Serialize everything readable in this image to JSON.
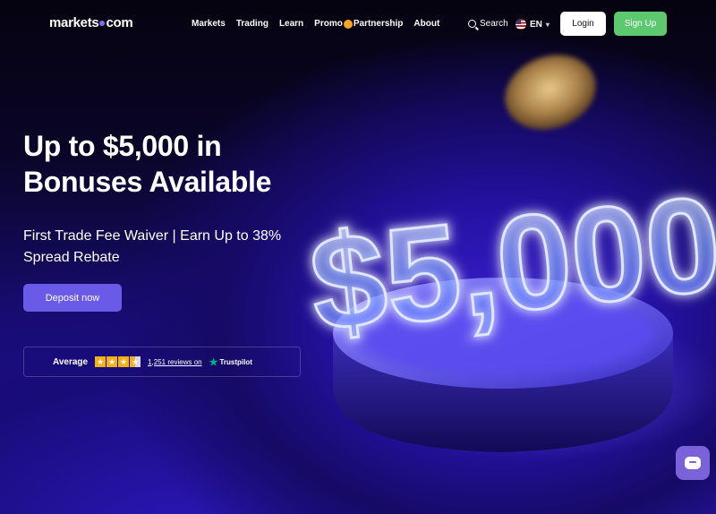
{
  "nav": {
    "logo_left": "markets",
    "logo_right": "com",
    "links": [
      "Markets",
      "Trading",
      "Learn"
    ],
    "promo_left": "Promo",
    "promo_right": "Partnership",
    "about": "About",
    "search": "Search",
    "language": "EN",
    "login": "Login",
    "signup": "Sign Up"
  },
  "hero": {
    "headline": "Up to $5,000 in Bonuses Available",
    "subhead": "First Trade Fee Waiver | Earn Up to 38% Spread Rebate",
    "cta": "Deposit now",
    "art_text": "$5,000"
  },
  "trust": {
    "rating_label": "Average",
    "stars": 3.5,
    "reviews": "1,251 reviews on",
    "brand": "Trustpilot"
  },
  "colors": {
    "accent": "#6a5ae8",
    "signup": "#5cc86f",
    "trustpilot_green": "#00b67a",
    "star": "#f5b01a"
  },
  "icons": {
    "search": "search-icon",
    "flag": "us-flag-icon",
    "chevron": "chevron-down-icon",
    "chat": "chat-icon"
  }
}
